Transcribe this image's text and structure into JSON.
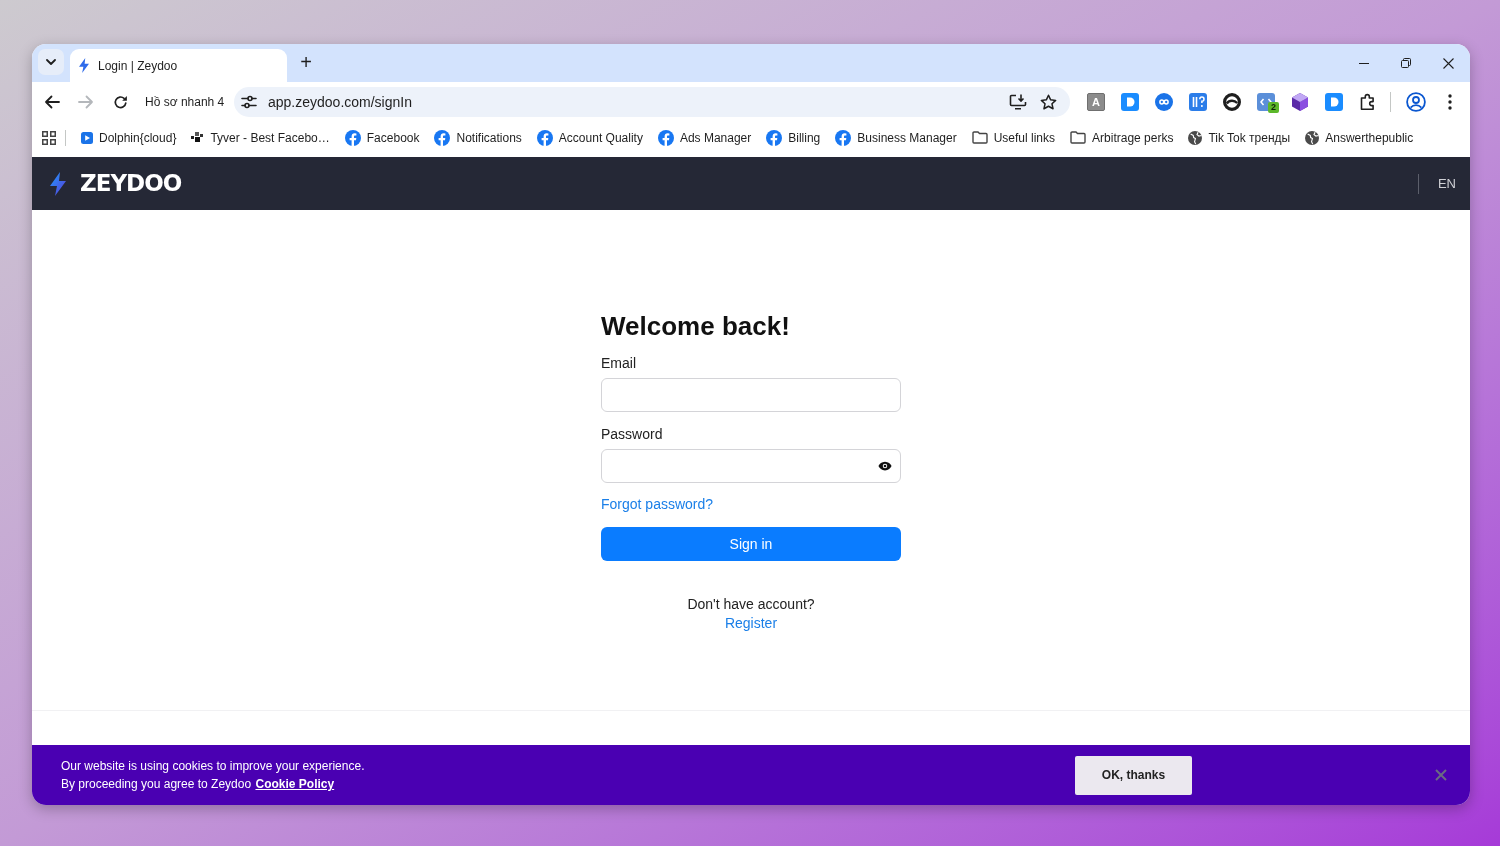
{
  "browser": {
    "tabs": [
      {
        "title": "Login | Zeydoo",
        "selected": true
      }
    ],
    "new_tab": "+",
    "nav_buttons": [
      {
        "kind": "back",
        "disabled": false
      },
      {
        "kind": "forward",
        "disabled": true
      },
      {
        "kind": "reload",
        "disabled": false
      }
    ],
    "profile_chip": "Hồ sơ nhanh 4",
    "address": "app.zeydoo.com/signIn",
    "extensions": [
      {
        "kind": "letter",
        "label": "A"
      },
      {
        "kind": "app-tile"
      },
      {
        "kind": "infinity"
      },
      {
        "kind": "tile"
      },
      {
        "kind": "swirl"
      },
      {
        "kind": "code",
        "badge": "2"
      },
      {
        "kind": "cube"
      },
      {
        "kind": "app-tile"
      }
    ],
    "bookmarks": [
      {
        "kind": "app",
        "label": "Dolphin{cloud}"
      },
      {
        "kind": "pixel",
        "label": "Tyver - Best Facebo…"
      },
      {
        "kind": "facebook",
        "label": "Facebook"
      },
      {
        "kind": "facebook",
        "label": "Notifications"
      },
      {
        "kind": "facebook",
        "label": "Account Quality"
      },
      {
        "kind": "facebook",
        "label": "Ads Manager"
      },
      {
        "kind": "facebook",
        "label": "Billing"
      },
      {
        "kind": "facebook",
        "label": "Business Manager"
      },
      {
        "kind": "folder",
        "label": "Useful links"
      },
      {
        "kind": "folder",
        "label": "Arbitrage perks"
      },
      {
        "kind": "globe",
        "label": "Tik Tok тренды"
      },
      {
        "kind": "globe",
        "label": "Answerthepublic"
      }
    ]
  },
  "site_header": {
    "logo": "ZEYDOO",
    "language": "EN"
  },
  "login_form": {
    "title": "Welcome back!",
    "fields": [
      {
        "kind": "text",
        "label": "Email"
      },
      {
        "kind": "password",
        "label": "Password"
      }
    ],
    "forgot_link": "Forgot password?",
    "submit": "Sign in",
    "register_prompt": "Don't have account?",
    "register_link": "Register"
  },
  "cookie_banner": {
    "line_1": "Our website is using cookies to improve your experience.",
    "line_2": "By proceeding you agree to Zeydoo",
    "policy_link": "Cookie Policy",
    "accept_button": "OK, thanks"
  }
}
